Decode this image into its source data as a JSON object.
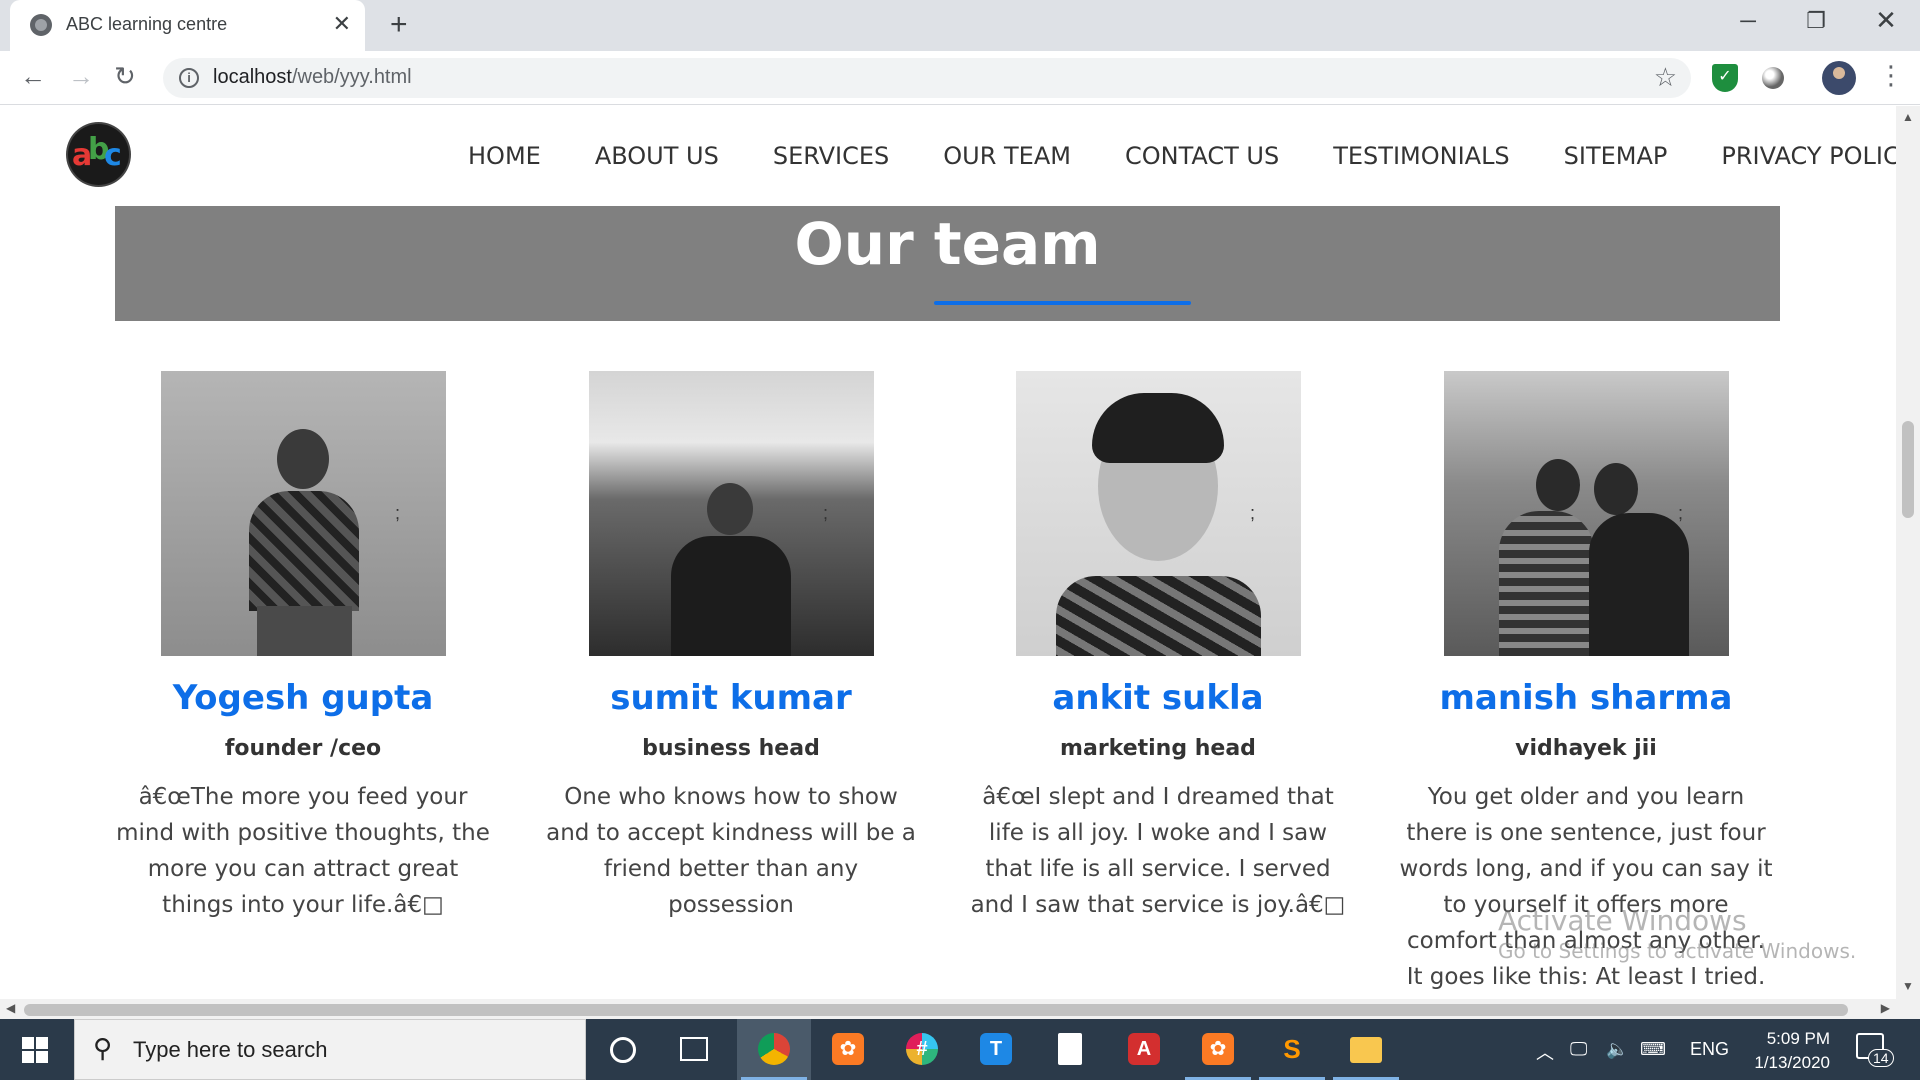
{
  "browser": {
    "tab_title": "ABC learning centre",
    "tab_close": "✕",
    "new_tab": "+",
    "url_host": "localhost",
    "url_path": "/web/yyy.html",
    "window_min": "─",
    "window_max": "❐",
    "window_close": "✕",
    "back": "←",
    "forward": "→",
    "reload": "↻",
    "star": "☆",
    "info": "i",
    "menu": "⋮"
  },
  "site": {
    "logo_letters": [
      "a",
      "b",
      "c"
    ],
    "nav": [
      "HOME",
      "ABOUT US",
      "SERVICES",
      "OUR TEAM",
      "CONTACT US",
      "TESTIMONIALS",
      "SITEMAP",
      "PRIVACY POLICY"
    ],
    "section_title": "Our team",
    "members": [
      {
        "name": "Yogesh gupta",
        "role": "founder /ceo",
        "quote": "â€œThe more you feed your mind with positive thoughts, the more you can attract great things into your life.â€□",
        "stray": ";"
      },
      {
        "name": "sumit kumar",
        "role": "business head",
        "quote": "One who knows how to show and to accept kindness will be a friend better than any possession",
        "stray": ";"
      },
      {
        "name": "ankit sukla",
        "role": "marketing head",
        "quote": "â€œI slept and I dreamed that life is all joy. I woke and I saw that life is all service. I served and I saw that service is joy.â€□",
        "stray": ";"
      },
      {
        "name": "manish sharma",
        "role": "vidhayek jii",
        "quote": "You get older and you learn there is one sentence, just four words long, and if you can say it to yourself it offers more comfort than almost any other. It goes like this: At least I tried.",
        "stray": ";"
      }
    ],
    "watermark_title": "Activate Windows",
    "watermark_sub": "Go to Settings to activate Windows."
  },
  "taskbar": {
    "search_placeholder": "Type here to search",
    "search_glyph": "⚲",
    "tray_lang": "ENG",
    "time": "5:09 PM",
    "date": "1/13/2020",
    "notif_count": "14",
    "apps": [
      {
        "name": "chrome",
        "glyph": "",
        "color": "#db4437"
      },
      {
        "name": "xampp",
        "glyph": "✿",
        "color": "#fb7a24"
      },
      {
        "name": "slack",
        "glyph": "#",
        "color": "#611f69"
      },
      {
        "name": "editor",
        "glyph": "T",
        "color": "#1e88e5"
      },
      {
        "name": "file",
        "glyph": "",
        "color": "#ffffff"
      },
      {
        "name": "acrobat",
        "glyph": "A",
        "color": "#d32f2f"
      },
      {
        "name": "xampp-2",
        "glyph": "✿",
        "color": "#fb7a24"
      },
      {
        "name": "sublime",
        "glyph": "S",
        "color": "#ff9800"
      },
      {
        "name": "explorer",
        "glyph": "",
        "color": "#f9c74f"
      }
    ]
  }
}
